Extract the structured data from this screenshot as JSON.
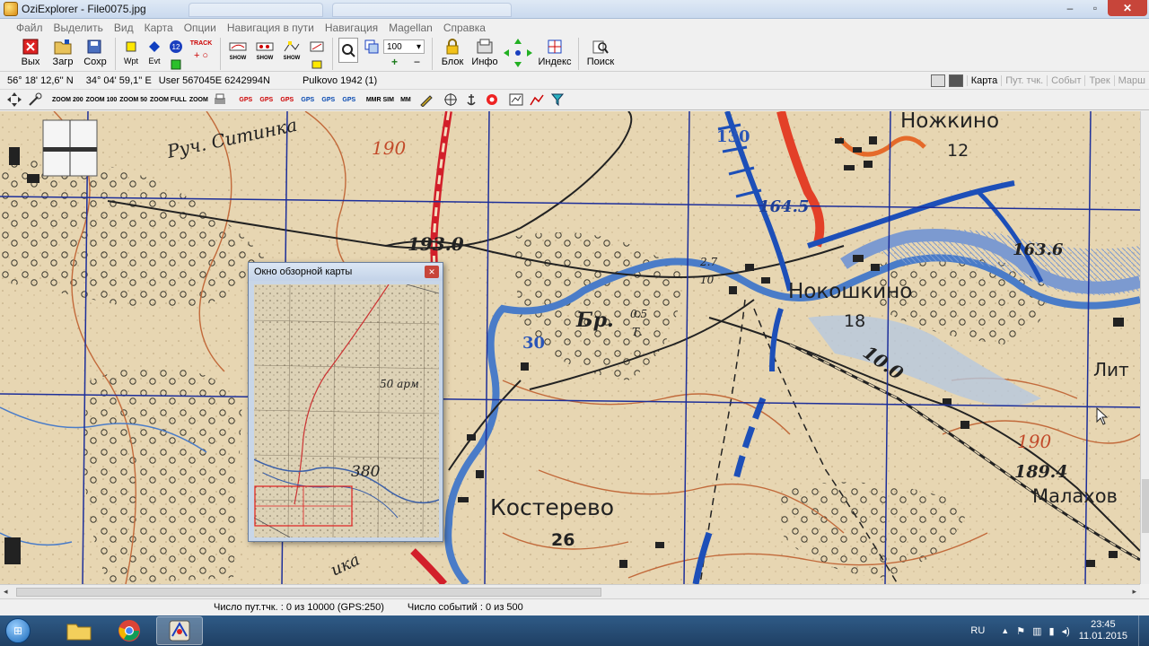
{
  "window": {
    "title": "OziExplorer - File0075.jpg",
    "minimize": "–",
    "maximize": "▫",
    "close": "✕"
  },
  "menu": [
    "Файл",
    "Выделить",
    "Вид",
    "Карта",
    "Опции",
    "Навигация в пути",
    "Навигация",
    "Magellan",
    "Справка"
  ],
  "toolbar": {
    "exit": "Вых",
    "load": "Загр",
    "save": "Сохр",
    "wpt": "Wpt",
    "evt": "Evt",
    "track_label": "TRACK",
    "show_label": "SHOW",
    "zoom_value": "100",
    "lock": "Блок",
    "info": "Инфо",
    "index": "Индекс",
    "search": "Поиск"
  },
  "coords": {
    "lat": "56° 18' 12,6'' N",
    "lon": "34° 04' 59,1'' E",
    "grid": "User  567045E  6242994N",
    "datum": "Pulkovo 1942 (1)"
  },
  "panel_tabs": [
    "Карта",
    "Пут. тчк.",
    "Событ",
    "Трек",
    "Марш"
  ],
  "map_toolbar": {
    "zoom200": "ZOOM 200",
    "zoom100": "ZOOM 100",
    "zoom50": "ZOOM 50",
    "zoomfull": "ZOOM FULL",
    "zoom_other": "ZOOM",
    "gps": "GPS",
    "mmsim": "MMR SIM",
    "mm": "MM"
  },
  "map": {
    "labels": [
      {
        "text": "Руч. Ситинка"
      },
      {
        "text": "190"
      },
      {
        "text": "193.0"
      },
      {
        "text": "130"
      },
      {
        "text": "Ножкино"
      },
      {
        "text": "12"
      },
      {
        "text": "164.5"
      },
      {
        "text": "163.6"
      },
      {
        "text": "Нокошкино"
      },
      {
        "text": "18"
      },
      {
        "text": "Бр."
      },
      {
        "text": "0.5"
      },
      {
        "text": "Т."
      },
      {
        "text": "2.7"
      },
      {
        "text": "10"
      },
      {
        "text": "30"
      },
      {
        "text": "10.0"
      },
      {
        "text": "Лит"
      },
      {
        "text": "190"
      },
      {
        "text": "189.4"
      },
      {
        "text": "Малахов"
      },
      {
        "text": "Костерево"
      },
      {
        "text": "26"
      },
      {
        "text": "ика"
      }
    ]
  },
  "overview": {
    "title": "Окно обзорной карты",
    "label1": "50 арм",
    "label2": "380"
  },
  "status": {
    "waypoints": "Число пут.тчк. : 0 из 10000  (GPS:250)",
    "events": "Число событий : 0 из 500"
  },
  "taskbar": {
    "lang": "RU",
    "time": "23:45",
    "date": "11.01.2015"
  },
  "colors": {
    "map_paper": "#e7d6b2",
    "river": "#3f6fc4",
    "road_red": "#d21f2a",
    "grid_blue": "#1d2f9a",
    "contour": "#c26a3b"
  }
}
